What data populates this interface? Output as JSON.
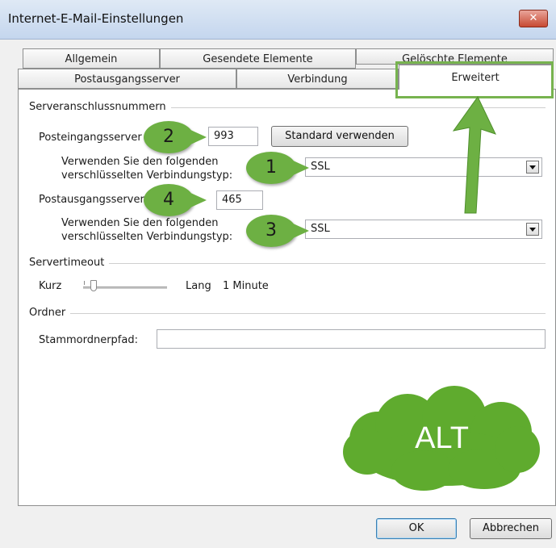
{
  "window": {
    "title": "Internet-E-Mail-Einstellungen",
    "close_label": "✕"
  },
  "tabs_row1": [
    {
      "label": "Allgemein"
    },
    {
      "label": "Gesendete Elemente"
    },
    {
      "label": "Gelöschte Elemente"
    }
  ],
  "tabs_row2": [
    {
      "label": "Postausgangsserver"
    },
    {
      "label": "Verbindung"
    },
    {
      "label": "Erweitert",
      "active": true
    }
  ],
  "server_ports": {
    "group_label": "Serveranschlussnummern",
    "incoming_label": "Posteingangsserver (IMAP):",
    "incoming_value": "993",
    "default_button": "Standard verwenden",
    "encryption_label_1a": "Verwenden Sie den folgenden",
    "encryption_label_1b": "verschlüsselten Verbindungstyp:",
    "incoming_encryption": "SSL",
    "outgoing_label": "Postausgangsserver (SMTP):",
    "outgoing_value": "465",
    "encryption_label_2a": "Verwenden Sie den folgenden",
    "encryption_label_2b": "verschlüsselten Verbindungstyp:",
    "outgoing_encryption": "SSL"
  },
  "timeout": {
    "group_label": "Servertimeout",
    "short_label": "Kurz",
    "long_label": "Lang",
    "value_label": "1 Minute"
  },
  "folders": {
    "group_label": "Ordner",
    "root_path_label": "Stammordnerpfad:",
    "root_path_value": ""
  },
  "buttons": {
    "ok": "OK",
    "cancel": "Abbrechen"
  },
  "annotations": {
    "bubble_1": "1",
    "bubble_2": "2",
    "bubble_3": "3",
    "bubble_4": "4",
    "cloud_text": "ALT",
    "accent_color": "#6db043"
  }
}
